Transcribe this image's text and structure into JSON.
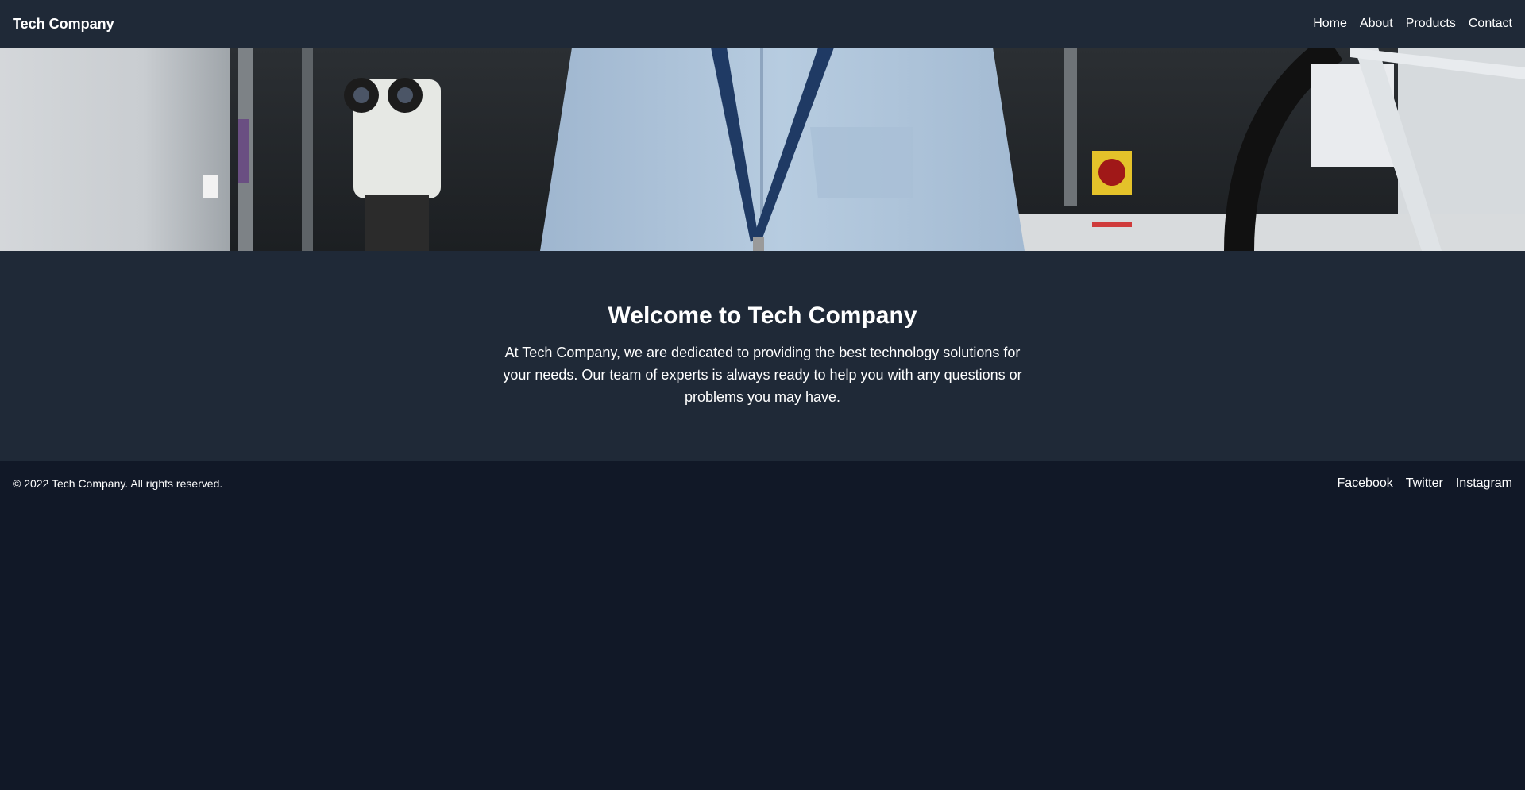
{
  "header": {
    "brand": "Tech Company",
    "nav": [
      "Home",
      "About",
      "Products",
      "Contact"
    ]
  },
  "hero": {
    "image": "lab-technician-photo"
  },
  "welcome": {
    "title": "Welcome to Tech Company",
    "body": "At Tech Company, we are dedicated to providing the best technology solutions for your needs. Our team of experts is always ready to help you with any questions or problems you may have."
  },
  "footer": {
    "copyright": "© 2022 Tech Company. All rights reserved.",
    "social": [
      "Facebook",
      "Twitter",
      "Instagram"
    ]
  },
  "colors": {
    "header_bg": "#1f2937",
    "page_bg": "#111827",
    "text": "#ffffff"
  }
}
